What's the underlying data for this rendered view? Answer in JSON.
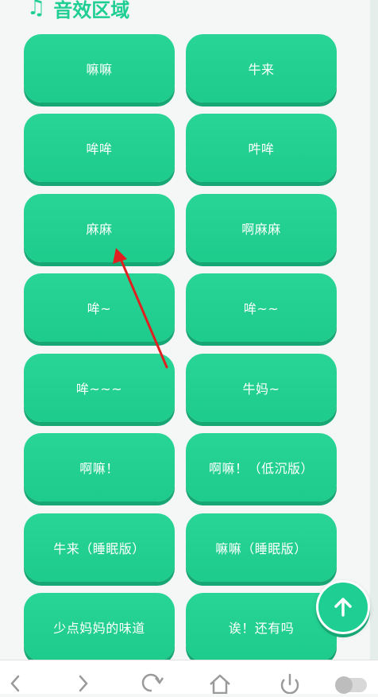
{
  "header": {
    "title": "音效区域",
    "icon": "music-note-icon"
  },
  "buttons": [
    {
      "label": "嘛嘛"
    },
    {
      "label": "牛来"
    },
    {
      "label": "哞哞"
    },
    {
      "label": "吽哞"
    },
    {
      "label": "麻麻"
    },
    {
      "label": "啊麻麻"
    },
    {
      "label": "哞~"
    },
    {
      "label": "哞~~"
    },
    {
      "label": "哞~~~"
    },
    {
      "label": "牛妈~"
    },
    {
      "label": "啊嘛！"
    },
    {
      "label": "啊嘛！（低沉版）"
    },
    {
      "label": "牛来（睡眠版）"
    },
    {
      "label": "嘛嘛（睡眠版）"
    },
    {
      "label": "少点妈妈的味道"
    },
    {
      "label": "诶！还有吗"
    }
  ],
  "scroll_top": {
    "icon": "arrow-up-icon"
  },
  "browser_nav": {
    "items": [
      "back-icon",
      "forward-icon",
      "refresh-icon",
      "home-icon",
      "power-icon",
      "toggle-icon"
    ]
  },
  "colors": {
    "accent": "#1fce93",
    "button_shadow": "#17a774",
    "annotation_arrow": "#e02020"
  }
}
